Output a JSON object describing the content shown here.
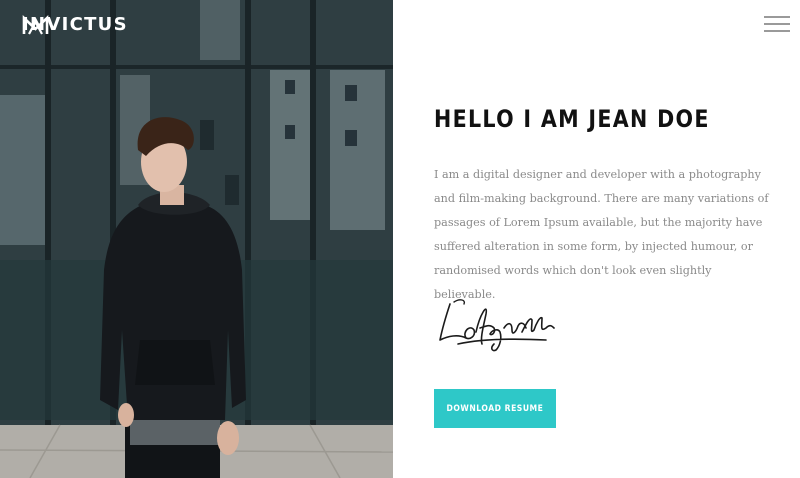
{
  "header": {
    "brand_name": "INVICTUS",
    "logo_icon": "brand-mark-icon",
    "menu_icon": "hamburger-menu-icon"
  },
  "about": {
    "headline": "HELLO I AM JEAN DOE",
    "intro": "I am a digital designer and developer with a photography and film-making background. There are many variations of passages of Lorem Ipsum available, but the majority have suffered alteration in some form, by injected humour, or randomised words which don't look even slightly believable.",
    "signature": "Lafayette",
    "download_label": "DOWNLOAD RESUME"
  },
  "colors": {
    "accent": "#2ec8c8",
    "headline": "#111111",
    "body_text": "#8a8a8a"
  }
}
